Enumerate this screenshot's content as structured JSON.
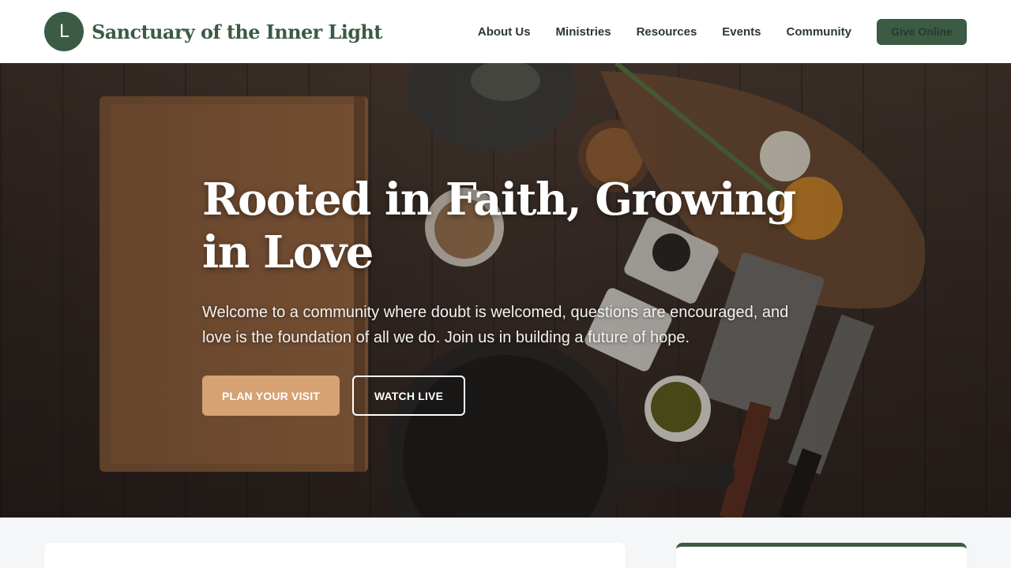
{
  "header": {
    "logo_letter": "L",
    "site_name": "Sanctuary of the Inner Light",
    "nav": [
      {
        "label": "About Us"
      },
      {
        "label": "Ministries"
      },
      {
        "label": "Resources"
      },
      {
        "label": "Events"
      },
      {
        "label": "Community"
      }
    ],
    "give_label": "Give Online"
  },
  "hero": {
    "title": "Rooted in Faith, Growing in Love",
    "text": "Welcome to a community where doubt is welcomed, questions are encouraged, and love is the foundation of all we do. Join us in building a future of hope.",
    "primary_cta": "PLAN YOUR VISIT",
    "secondary_cta": "WATCH LIVE"
  },
  "colors": {
    "brand_green": "#3b5b44",
    "accent_tan": "#d6a274",
    "page_background": "#f5f6f8"
  }
}
